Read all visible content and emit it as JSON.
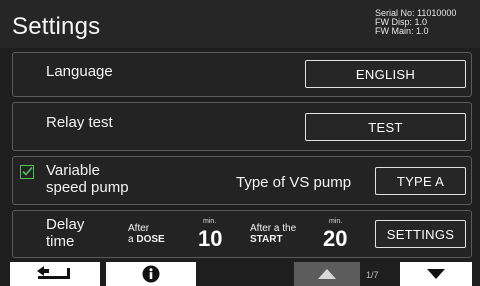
{
  "header": {
    "title": "Settings",
    "serial_no": "Serial No: 11010000",
    "fw_disp": "FW Disp: 1.0",
    "fw_main": "FW Main: 1.0"
  },
  "language": {
    "label": "Language",
    "value": "ENGLISH"
  },
  "relay": {
    "label": "Relay test",
    "button": "TEST"
  },
  "vs_pump": {
    "label_line1": "Variable",
    "label_line2": "speed pump",
    "checked": true,
    "type_label": "Type of VS pump",
    "type_value": "TYPE A"
  },
  "delay": {
    "label_line1": "Delay",
    "label_line2": "time",
    "after_line1": "After",
    "after_line2_prefix": "a ",
    "after_line2_bold": "DOSE",
    "dose_unit": "min.",
    "dose_value": "10",
    "start_line1": "After a the",
    "start_line2": "START",
    "start_unit": "min.",
    "start_value": "20",
    "settings_button": "SETTINGS"
  },
  "footer": {
    "back_icon": "back-arrow-icon",
    "info_icon": "info-icon",
    "up_icon": "triangle-up-icon",
    "down_icon": "triangle-down-icon",
    "page_indicator": "1/7"
  },
  "colors": {
    "background": "#1e1e1e",
    "border": "#5a5a5a",
    "checkbox_green": "#52c15a",
    "footer_button": "#ffffff",
    "footer_button_disabled": "#5c5c5c"
  }
}
